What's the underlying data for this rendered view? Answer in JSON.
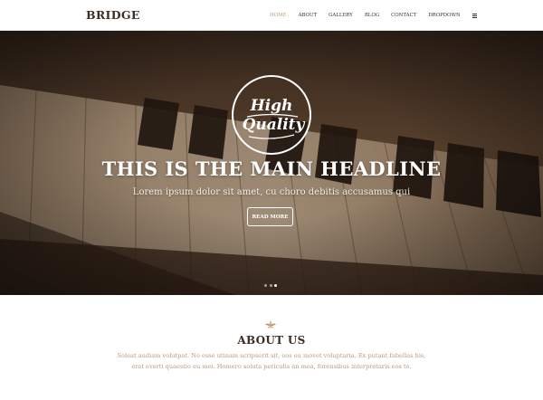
{
  "header": {
    "logo": "BRIDGE",
    "nav": [
      "HOME",
      "ABOUT",
      "GALLERY",
      "BLOG",
      "CONTACT",
      "DROPDOWN"
    ],
    "active_nav": "HOME",
    "menu_icon": "hamburger-menu-icon"
  },
  "hero": {
    "badge_line1": "High",
    "badge_line2": "Quality",
    "headline": "THIS IS THE MAIN HEADLINE",
    "subheadline": "Lorem ipsum dolor sit amet, cu choro debitis accusamus qui",
    "button_label": "READ MORE",
    "slides": 3,
    "active_slide": 3
  },
  "about": {
    "title": "ABOUT US",
    "text_line1": "Soleat audiam volutpat. No esse utinam scripserit sit, eos eu movet voluptaria. Ex putant fabellas his,",
    "text_line2": "erat everti quaestio eu mei. Homero soluta periculis an mea, forensibus interpretaris eos te."
  },
  "colors": {
    "accent": "#c29a6c",
    "dark_text": "#3c2e25",
    "muted_text": "#b69b7f"
  }
}
